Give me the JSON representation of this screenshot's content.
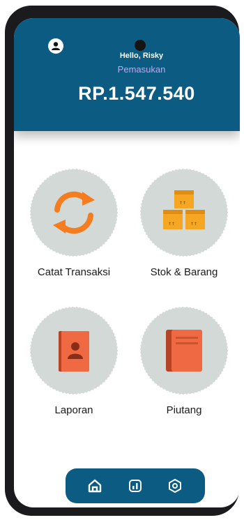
{
  "header": {
    "greeting": "Hello, Risky",
    "income_label": "Pemasukan",
    "income_amount": "RP.1.547.540"
  },
  "menu": {
    "items": [
      {
        "label": "Catat Transaksi",
        "icon": "refresh-icon",
        "color": "#f57c1f"
      },
      {
        "label": "Stok & Barang",
        "icon": "boxes-icon",
        "color": "#f5a623"
      },
      {
        "label": "Laporan",
        "icon": "contact-book-icon",
        "color": "#ef6a43"
      },
      {
        "label": "Piutang",
        "icon": "book-icon",
        "color": "#ef6a43"
      }
    ]
  },
  "bottom_nav": {
    "items": [
      {
        "icon": "home-icon"
      },
      {
        "icon": "chart-icon"
      },
      {
        "icon": "settings-icon"
      }
    ]
  },
  "colors": {
    "primary": "#0b5b83",
    "income_label": "#bfa8f0",
    "circle_bg": "#d3d9d6"
  }
}
